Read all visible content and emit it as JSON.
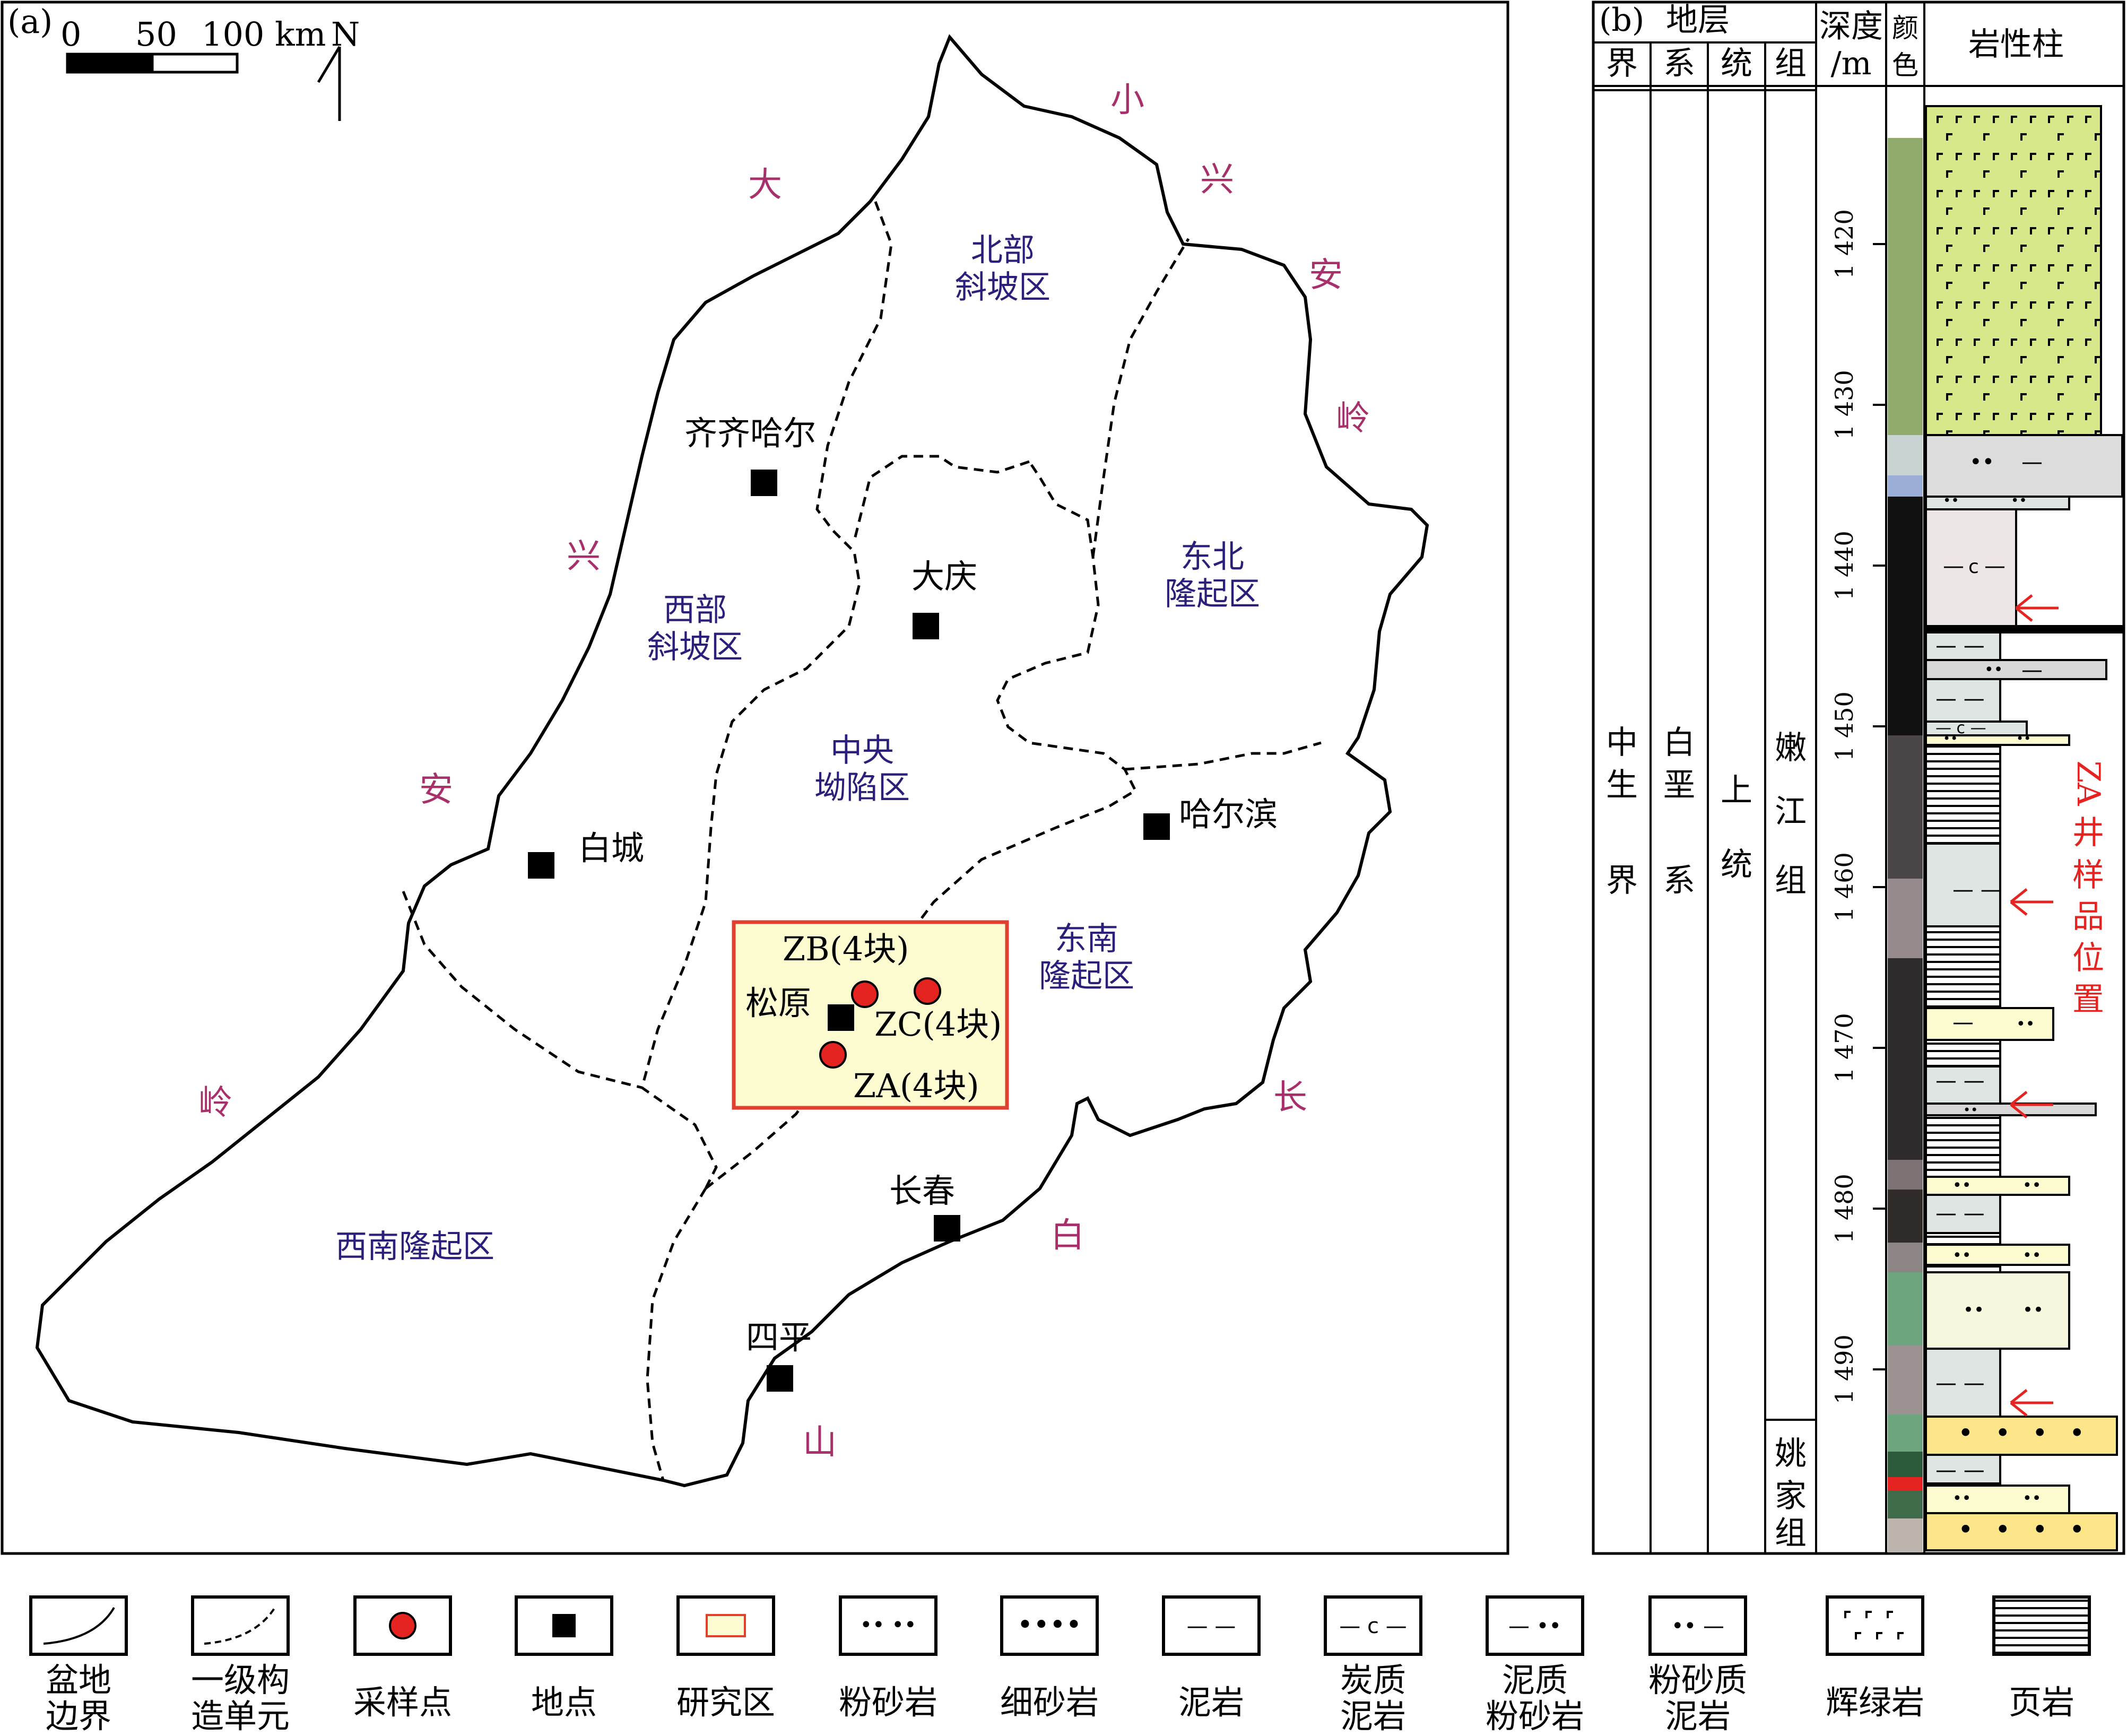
{
  "panel_a": {
    "tag": "(a)",
    "scale": {
      "t0": "0",
      "t50": "50",
      "t100": "100 km"
    },
    "north": "N",
    "mountains": [
      "小",
      "兴",
      "安",
      "岭",
      "大",
      "兴",
      "安",
      "岭",
      "长",
      "白",
      "山"
    ],
    "units": {
      "north_slope_1": "北部",
      "north_slope_2": "斜坡区",
      "west_slope_1": "西部",
      "west_slope_2": "斜坡区",
      "central_1": "中央",
      "central_2": "坳陷区",
      "ne_uplift_1": "东北",
      "ne_uplift_2": "隆起区",
      "se_uplift_1": "东南",
      "se_uplift_2": "隆起区",
      "sw_uplift": "西南隆起区"
    },
    "cities": [
      "齐齐哈尔",
      "大庆",
      "白城",
      "哈尔滨",
      "松原",
      "长春",
      "四平"
    ],
    "samples": {
      "zb": "ZB(4块)",
      "zc": "ZC(4块)",
      "za": "ZA(4块)"
    }
  },
  "panel_b": {
    "tag": "(b)",
    "strata": "地层",
    "col_jie": "界",
    "col_xi": "系",
    "col_tong": "统",
    "col_zu": "组",
    "depth_1": "深度",
    "depth_2": "/m",
    "color_1": "颜",
    "color_2": "色",
    "litho": "岩性柱",
    "era": [
      "中",
      "生",
      "界"
    ],
    "system": [
      "白",
      "垩",
      "系"
    ],
    "series": [
      "上",
      "统"
    ],
    "fm1": [
      "嫩",
      "江",
      "组"
    ],
    "fm2": [
      "姚",
      "家",
      "组"
    ],
    "depth_ticks": [
      "1 420",
      "1 430",
      "1 440",
      "1 450",
      "1 460",
      "1 470",
      "1 480",
      "1 490"
    ],
    "sample_note": [
      "ZA",
      "井",
      "样",
      "品",
      "位",
      "置"
    ]
  },
  "legend": {
    "basin": [
      "盆地",
      "边界"
    ],
    "tect": [
      "一级构",
      "造单元"
    ],
    "sample": [
      "采样点"
    ],
    "site": [
      "地点"
    ],
    "study": [
      "研究区"
    ],
    "siltstone": [
      "粉砂岩"
    ],
    "finesand": [
      "细砂岩"
    ],
    "mudstone": [
      "泥岩"
    ],
    "carbmud": [
      "炭质",
      "泥岩"
    ],
    "mudsilt": [
      "泥质",
      "粉砂岩"
    ],
    "siltmud": [
      "粉砂质",
      "泥岩"
    ],
    "diabase": [
      "辉绿岩"
    ],
    "shale": [
      "页岩"
    ]
  },
  "colors": {
    "mountain": "#a8306a",
    "unit": "#2a1f7a",
    "sample": "#e52421",
    "study_fill": "#fdfbd0",
    "study_border": "#e04030",
    "diabase": "#d6e88a"
  }
}
